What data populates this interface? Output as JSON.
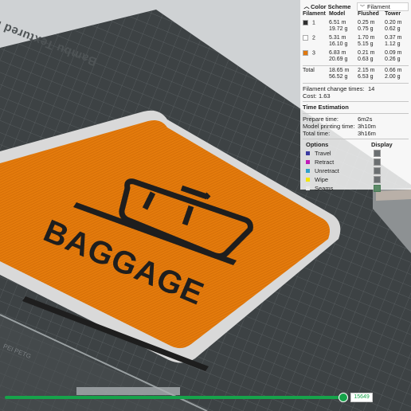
{
  "bed": {
    "label": "Bambu Textured PEI Plate",
    "side_label": "PEI PETG"
  },
  "sign": {
    "text": "BAGGAGE"
  },
  "panel": {
    "title": "Color Scheme",
    "scheme": "Filament",
    "headers": [
      "Filament",
      "Model",
      "Flushed",
      "Tower"
    ],
    "rows": [
      {
        "id": "1",
        "color": "#2f2f2f",
        "model": [
          "6.51 m",
          "19.72 g"
        ],
        "flushed": [
          "0.25 m",
          "0.75 g"
        ],
        "tower": [
          "0.20 m",
          "0.62 g"
        ]
      },
      {
        "id": "2",
        "color": "#ffffff",
        "model": [
          "5.31 m",
          "16.10 g"
        ],
        "flushed": [
          "1.70 m",
          "5.15 g"
        ],
        "tower": [
          "0.37 m",
          "1.12 g"
        ]
      },
      {
        "id": "3",
        "color": "#e0780e",
        "model": [
          "6.83 m",
          "20.69 g"
        ],
        "flushed": [
          "0.21 m",
          "0.63 g"
        ],
        "tower": [
          "0.09 m",
          "0.26 g"
        ]
      }
    ],
    "total": {
      "label": "Total",
      "model": [
        "18.65 m",
        "56.52 g"
      ],
      "flushed": [
        "2.15 m",
        "6.53 g"
      ],
      "tower": [
        "0.66 m",
        "2.00 g"
      ]
    },
    "filament_change_label": "Filament change times:",
    "filament_change_value": "14",
    "cost_label": "Cost:",
    "cost_value": "1.63",
    "time_title": "Time Estimation",
    "times": [
      {
        "label": "Prepare time:",
        "value": "6m2s"
      },
      {
        "label": "Model printing time:",
        "value": "3h10m"
      },
      {
        "label": "Total time:",
        "value": "3h16m"
      }
    ],
    "options_title": "Options",
    "display_title": "Display",
    "options": [
      {
        "label": "Travel",
        "color": "#3b3ba0",
        "on": false
      },
      {
        "label": "Retract",
        "color": "#c01ab8",
        "on": false
      },
      {
        "label": "Unretract",
        "color": "#2fa0c8",
        "on": false
      },
      {
        "label": "Wipe",
        "color": "#f2e600",
        "on": false
      },
      {
        "label": "Seams",
        "color": "#e8e8e8",
        "on": true
      }
    ]
  },
  "slider": {
    "value": "15649",
    "position": 0.84
  }
}
